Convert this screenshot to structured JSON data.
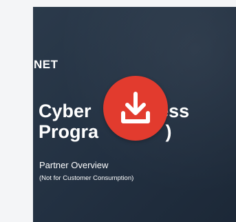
{
  "document": {
    "brand": "NET",
    "title": "Cyber         ssess\nProgra             )",
    "subtitle": "Partner Overview",
    "note": "(Not for Customer Consumption)"
  },
  "download": {
    "icon": "download-icon",
    "color": "#e23b2e"
  },
  "colors": {
    "background": "#f4f5f7",
    "document_background": "#243243"
  }
}
